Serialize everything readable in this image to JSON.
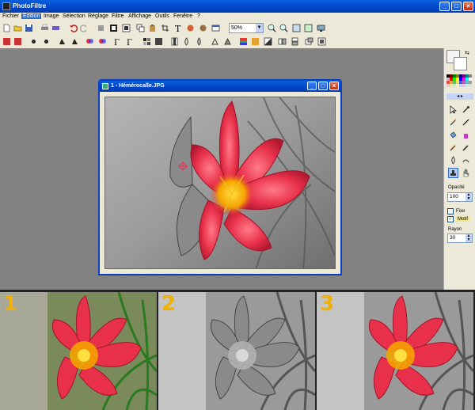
{
  "app": {
    "title": "PhotoFiltre",
    "window_controls": {
      "minimize": "_",
      "maximize": "□",
      "close": "×"
    }
  },
  "menu": {
    "items": [
      "Fichier",
      "Edition",
      "Image",
      "Sélection",
      "Réglage",
      "Filtre",
      "Affichage",
      "Outils",
      "Fenêtre",
      "?"
    ],
    "active": "Edition"
  },
  "toolbar": {
    "zoom_value": "50%",
    "zoom_arrow": "▼"
  },
  "document": {
    "title": "1 - Hémérocalle.JPG",
    "window_controls": {
      "minimize": "_",
      "maximize": "□",
      "close": "×"
    }
  },
  "tools_panel": {
    "opacity_label": "Opacité",
    "opacity_value": "100",
    "fixe_label": "Fixe",
    "motif_label": "Motif",
    "motif_checked": "✓",
    "radius_label": "Rayon",
    "radius_value": "30",
    "spin_up": "▲",
    "spin_down": "▼"
  },
  "comparison": {
    "labels": [
      "1",
      "2",
      "3"
    ]
  },
  "colors": {
    "accent_titlebar": "#0046c8",
    "flower_red": "#e8304a",
    "flower_center": "#f5a200",
    "panel_number": "#f2b000"
  }
}
